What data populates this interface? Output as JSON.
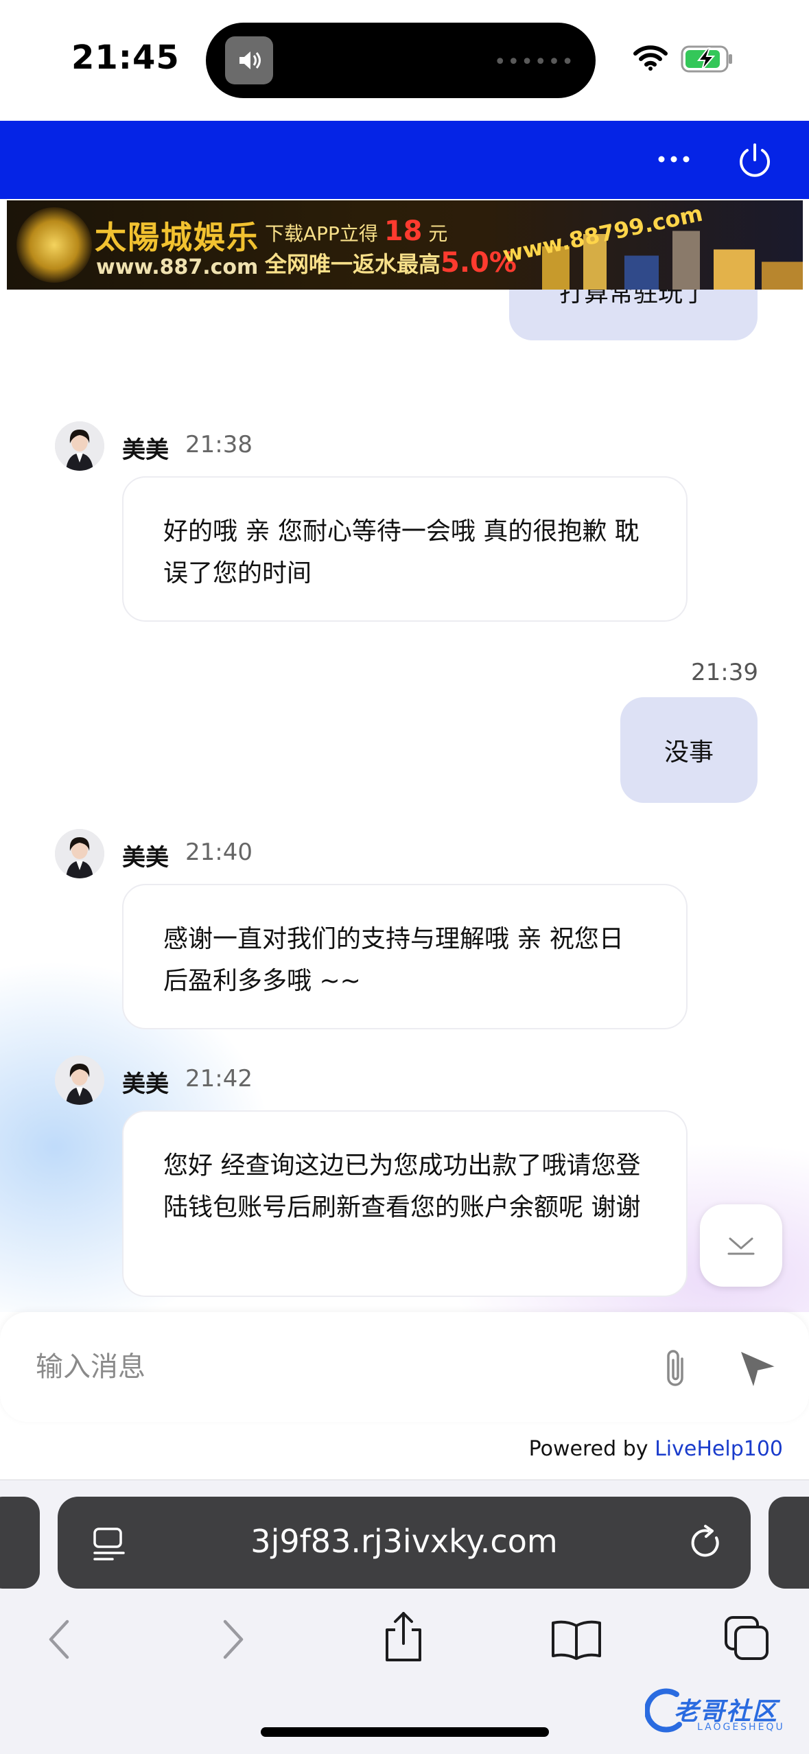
{
  "status_bar": {
    "time": "21:45",
    "island_dots": "••••••"
  },
  "ad": {
    "brand": "太陽城娛乐",
    "brand_url": "www.887.com",
    "line1_prefix": "下载APP立得",
    "line1_number": "18",
    "line1_suffix": "元",
    "line2_prefix": "全网唯一返水最高",
    "line2_percent": "5.0%",
    "site": "www.88799.com"
  },
  "chat": {
    "partial_out_message": "打算常驻玩了",
    "messages": [
      {
        "sender": "美美",
        "time": "21:38",
        "text": "好的哦 亲 您耐心等待一会哦 真的很抱歉 耽误了您的时间"
      },
      {
        "time": "21:39",
        "text": "没事"
      },
      {
        "sender": "美美",
        "time": "21:40",
        "text": "感谢一直对我们的支持与理解哦 亲 祝您日后盈利多多哦 ~~"
      },
      {
        "sender": "美美",
        "time": "21:42",
        "text": "您好 经查询这边已为您成功出款了哦请您登陆钱包账号后刷新查看您的账户余额呢 谢谢"
      }
    ]
  },
  "composer": {
    "placeholder": "输入消息",
    "value": ""
  },
  "powered_by": {
    "prefix": "Powered by",
    "brand": "LiveHelp100"
  },
  "safari": {
    "url": "3j9f83.rj3ivxky.com"
  },
  "watermark": {
    "text": "老哥社区",
    "sub": "LAOGESHEQU"
  },
  "colors": {
    "header_blue": "#0524e6",
    "outgoing_bubble": "#dde1f5",
    "link_blue": "#1a3ccc"
  }
}
